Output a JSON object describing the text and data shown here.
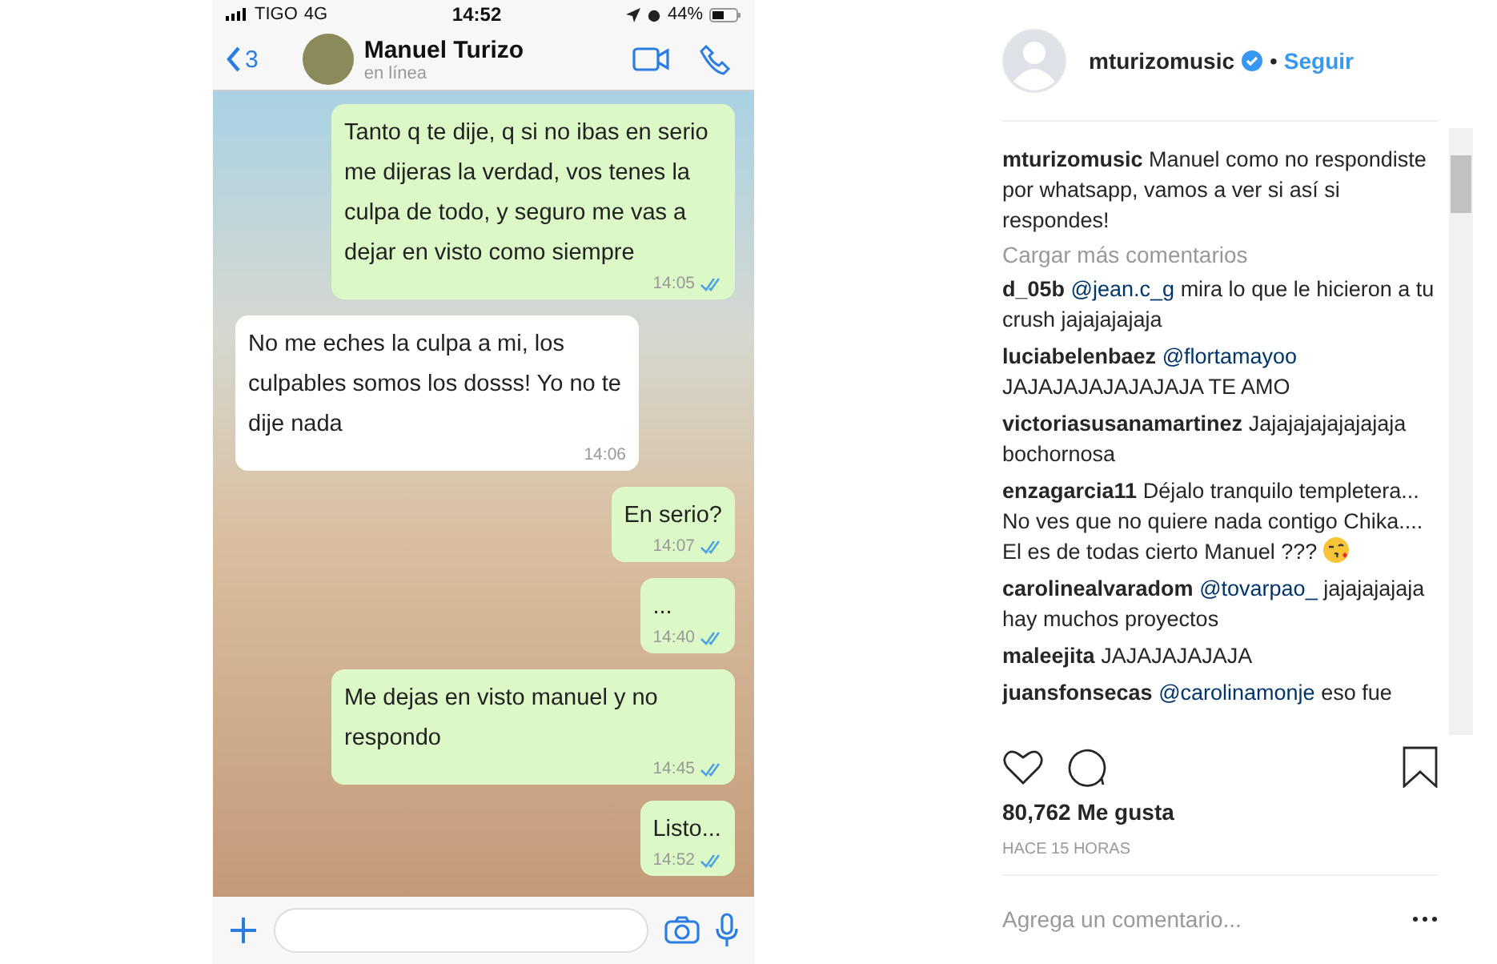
{
  "phone": {
    "status_bar": {
      "carrier": "TIGO",
      "network": "4G",
      "time": "14:52",
      "battery": "44%"
    },
    "header": {
      "back_count": "3",
      "contact": "Manuel Turizo",
      "presence": "en línea"
    },
    "messages": [
      {
        "kind": "outgoing",
        "text": "Tanto q te dije, q si no ibas en serio me dijeras la verdad, vos tenes la culpa de todo, y seguro me vas a dejar en visto como siempre",
        "time": "14:05"
      },
      {
        "kind": "incoming",
        "text": "No me eches la culpa a mi, los culpables somos los dosss! Yo no te dije nada",
        "time": "14:06"
      },
      {
        "kind": "outgoing",
        "text": "En serio?",
        "time": "14:07"
      },
      {
        "kind": "outgoing",
        "text": "...",
        "time": "14:40"
      },
      {
        "kind": "outgoing",
        "text": "Me dejas en visto manuel y no respondo",
        "time": "14:45"
      },
      {
        "kind": "outgoing",
        "text": "Listo...",
        "time": "14:52"
      }
    ]
  },
  "post": {
    "username": "mturizomusic",
    "separator": "•",
    "follow": "Seguir",
    "caption": {
      "user": "mturizomusic",
      "text": "Manuel como no respondiste por whatsapp, vamos a ver si así si respondes!"
    },
    "load_more": "Cargar más comentarios",
    "comments": [
      {
        "user": "d_05b",
        "mention": "@jean.c_g",
        "text": "mira lo que le hicieron a tu crush jajajajajaja"
      },
      {
        "user": "luciabelenbaez",
        "mention": "@flortamayoo",
        "text": "JAJAJAJAJAJAJAJA TE AMO"
      },
      {
        "user": "victoriasusanamartinez",
        "text": "Jajajajajajajajaja bochornosa"
      },
      {
        "user": "enzagarcia11",
        "text": "Déjalo tranquilo templetera... No ves que no quiere nada contigo Chika.... El es de todas cierto Manuel ???",
        "emoji": true
      },
      {
        "user": "carolinealvaradom",
        "mention": "@tovarpao_",
        "text": "jajajajajaja hay muchos proyectos"
      },
      {
        "user": "maleejita",
        "text": "JAJAJAJAJAJA"
      },
      {
        "user": "juansfonsecas",
        "mention": "@carolinamonje",
        "text": "eso fue"
      }
    ],
    "likes": "80,762 Me gusta",
    "time_ago": "HACE 15 HORAS",
    "comment_placeholder": "Agrega un comentario..."
  }
}
